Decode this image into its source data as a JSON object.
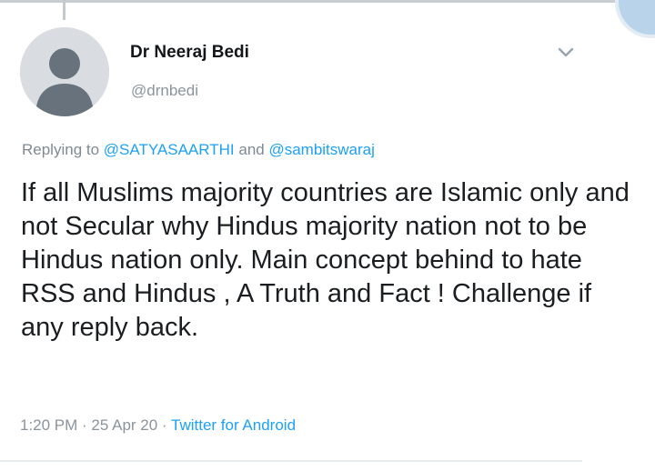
{
  "tweet": {
    "display_name": "Dr Neeraj Bedi",
    "handle": "@drnbedi",
    "replying_prefix": "Replying to ",
    "replying_mention_1": "@SATYASAARTHI",
    "replying_and": " and ",
    "replying_mention_2": "@sambitswaraj",
    "text": "If all Muslims majority countries are Islamic only and not Secular why Hindus majority nation not to be Hindus nation only. Main concept behind to hate RSS and Hindus , A Truth and Fact ! Challenge if any reply back.",
    "time": "1:20 PM",
    "separator_1": " · ",
    "date": "25 Apr 20",
    "separator_2": " · ",
    "source": "Twitter for Android"
  },
  "icons": {
    "avatar": "default-profile-icon",
    "menu": "chevron-down-icon"
  },
  "colors": {
    "link": "#1da1f2",
    "secondary_text": "#8a949c",
    "primary_text": "#14171a"
  }
}
